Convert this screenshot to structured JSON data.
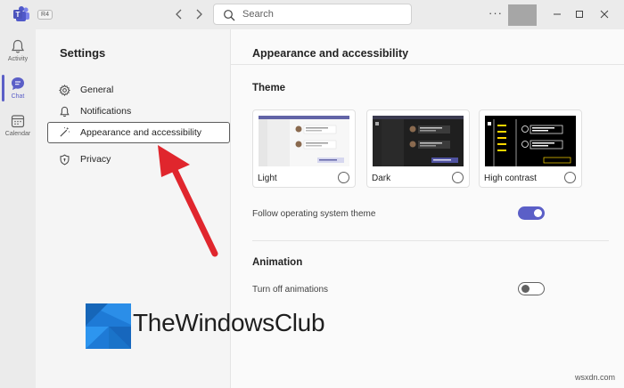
{
  "titlebar": {
    "badge": "R4",
    "search_placeholder": "Search",
    "more": "···"
  },
  "rail": {
    "items": [
      {
        "label": "Activity",
        "icon": "bell-icon"
      },
      {
        "label": "Chat",
        "icon": "chat-icon",
        "active": true
      },
      {
        "label": "Calendar",
        "icon": "calendar-icon"
      }
    ]
  },
  "settings": {
    "title": "Settings",
    "items": [
      {
        "label": "General",
        "icon": "gear-icon"
      },
      {
        "label": "Notifications",
        "icon": "bell-icon"
      },
      {
        "label": "Appearance and accessibility",
        "icon": "magic-wand-icon",
        "selected": true
      },
      {
        "label": "Privacy",
        "icon": "shield-icon"
      }
    ]
  },
  "main": {
    "title": "Appearance and accessibility",
    "theme_section": "Theme",
    "themes": [
      {
        "label": "Light"
      },
      {
        "label": "Dark"
      },
      {
        "label": "High contrast"
      }
    ],
    "follow_os_label": "Follow operating system theme",
    "follow_os_on": true,
    "animation_section": "Animation",
    "turn_off_animations_label": "Turn off animations",
    "turn_off_animations_on": false
  },
  "watermark": {
    "brand": "TheWindowsClub",
    "site": "wsxdn.com"
  },
  "colors": {
    "accent": "#5b5fc7",
    "arrow": "#e0262d"
  }
}
